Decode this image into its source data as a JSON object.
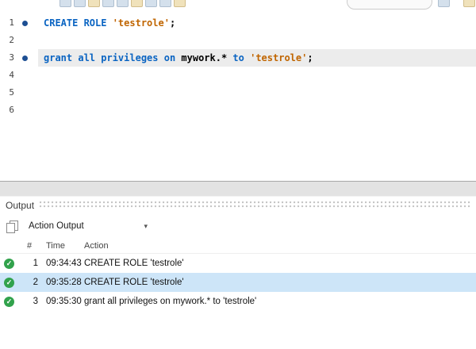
{
  "colors": {
    "keyword_blue": "#0a64c2",
    "string_orange": "#c06500",
    "marker_navy": "#1d4f93",
    "success_green": "#31a24c",
    "selection_blue": "#cde5f8",
    "line_highlight": "#ececec"
  },
  "icons": {
    "dropdown": "▾",
    "success": "✓"
  },
  "editor": {
    "line_numbers": [
      "1",
      "2",
      "3",
      "4",
      "5",
      "6"
    ],
    "line1": {
      "kw": "CREATE ROLE ",
      "str": "'testrole'",
      "end": ";"
    },
    "line3": {
      "kw1": "grant all privileges on ",
      "plain1": "mywork.* ",
      "kw2": "to ",
      "str": "'testrole'",
      "end": ";"
    }
  },
  "output": {
    "title": "Output",
    "selector_value": "Action Output",
    "columns": {
      "index": "#",
      "time": "Time",
      "action": "Action"
    },
    "rows": [
      {
        "index": "1",
        "time": "09:34:43",
        "action": "CREATE ROLE 'testrole'",
        "status": "success",
        "selected": false
      },
      {
        "index": "2",
        "time": "09:35:28",
        "action": "CREATE ROLE 'testrole'",
        "status": "success",
        "selected": true
      },
      {
        "index": "3",
        "time": "09:35:30",
        "action": "grant all privileges on mywork.* to 'testrole'",
        "status": "success",
        "selected": false
      }
    ]
  }
}
